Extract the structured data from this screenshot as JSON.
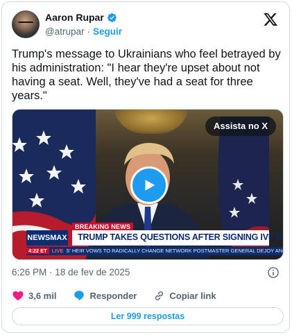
{
  "author": {
    "name": "Aaron Rupar",
    "handle": "@atrupar",
    "separator": "·",
    "follow_label": "Seguir"
  },
  "tweet_text": "Trump's message to Ukrainians who feel betrayed by his administration: \"I hear they're upset about not having a seat. Well, they've had a seat for three years.\"",
  "media": {
    "watch_label": "Assista no X",
    "breaking": "BREAKING NEWS",
    "channel": "NEWSMAX",
    "headline": "TRUMP TAKES QUESTIONS AFTER SIGNING IVF ORDER",
    "ticker_time": "4:22 ET",
    "ticker_live": "LIVE",
    "ticker_text": "S' HEIR VOWS TO RADICALLY CHANGE NETWORK     POSTMASTER GENERAL DEJOY ANNOU"
  },
  "timestamp": "6:26 PM · 18 de fev de 2025",
  "actions": {
    "like_count": "3,6 mil",
    "reply_label": "Responder",
    "copy_link_label": "Copiar link"
  },
  "read_replies_label": "Ler 999 respostas",
  "colors": {
    "accent": "#1d9bf0",
    "like": "#f91880",
    "text": "#0f1419",
    "muted": "#536471",
    "border": "#cfd9de"
  }
}
